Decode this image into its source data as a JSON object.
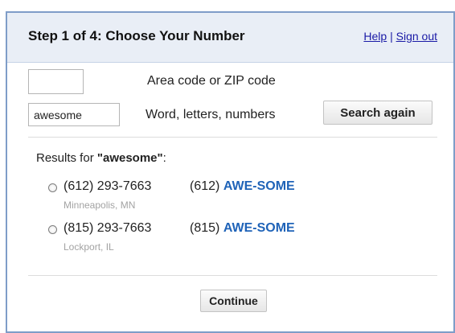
{
  "header": {
    "title": "Step 1 of 4: Choose Your Number",
    "help_link": "Help",
    "separator": "|",
    "signout_link": "Sign out"
  },
  "search": {
    "area_value": "",
    "area_label": "Area code or ZIP code",
    "word_value": "awesome",
    "word_label": "Word, letters, numbers",
    "search_button": "Search again"
  },
  "results": {
    "prefix": "Results for ",
    "query": "\"awesome\"",
    "suffix": ":",
    "items": [
      {
        "number": "(612) 293-7663",
        "location": "Minneapolis, MN",
        "word_area": "(612)",
        "word_text": "AWE-SOME"
      },
      {
        "number": "(815) 293-7663",
        "location": "Lockport, IL",
        "word_area": "(815)",
        "word_text": "AWE-SOME"
      }
    ]
  },
  "footer": {
    "continue_button": "Continue"
  },
  "colors": {
    "accent": "#1f63b8",
    "link": "#1a1aa6",
    "header_bg": "#e9eef6",
    "border": "#7f9dc8"
  }
}
